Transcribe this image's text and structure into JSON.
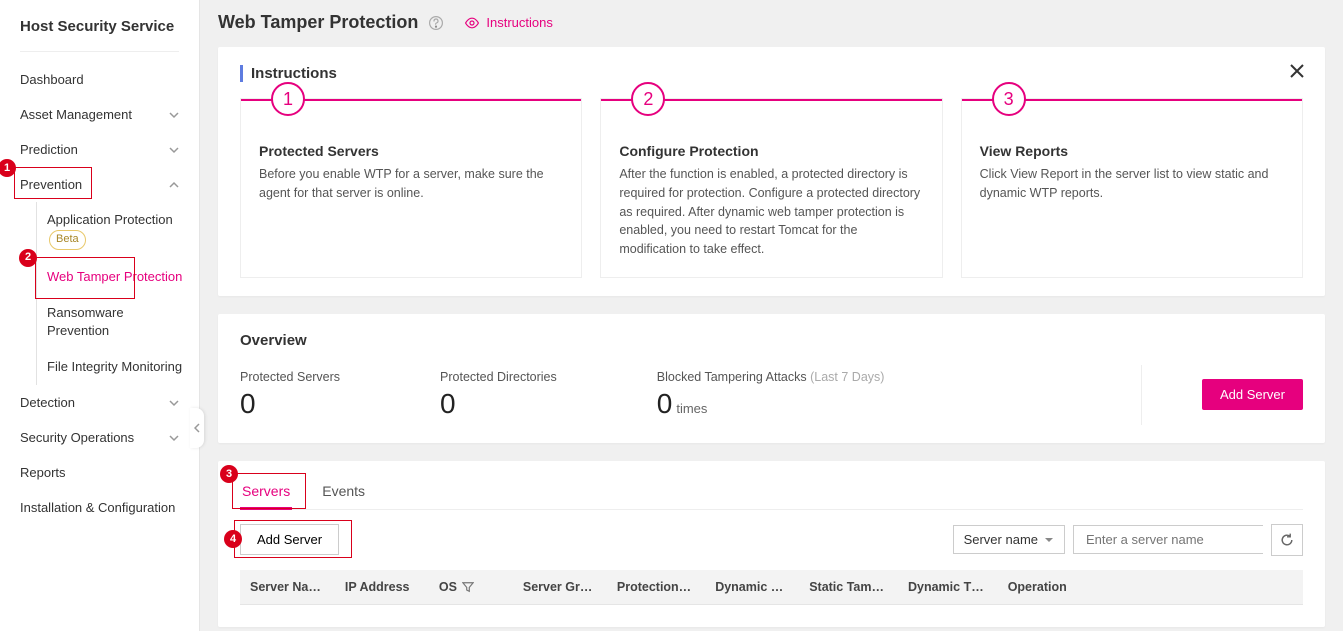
{
  "sidebar": {
    "service_title": "Host Security Service",
    "items": {
      "dashboard": "Dashboard",
      "asset_mgmt": "Asset Management",
      "prediction": "Prediction",
      "prevention": "Prevention",
      "detection": "Detection",
      "security_ops": "Security Operations",
      "reports": "Reports",
      "install_config": "Installation & Configuration"
    },
    "prevention_sub": {
      "app_protection": "Application Protection",
      "beta": "Beta",
      "wtp": "Web Tamper Protection",
      "ransomware": "Ransomware Prevention",
      "fim": "File Integrity Monitoring"
    }
  },
  "header": {
    "page_title": "Web Tamper Protection",
    "instructions_link": "Instructions"
  },
  "instructions": {
    "panel_title": "Instructions",
    "steps": [
      {
        "num": "1",
        "title": "Protected Servers",
        "body": "Before you enable WTP for a server, make sure the agent for that server is online."
      },
      {
        "num": "2",
        "title": "Configure Protection",
        "body": "After the function is enabled, a protected directory is required for protection. Configure a protected directory as required. After dynamic web tamper protection is enabled, you need to restart Tomcat for the modification to take effect."
      },
      {
        "num": "3",
        "title": "View Reports",
        "body": "Click View Report in the server list to view static and dynamic WTP reports."
      }
    ]
  },
  "overview": {
    "title": "Overview",
    "protected_servers_label": "Protected Servers",
    "protected_servers_value": "0",
    "protected_dirs_label": "Protected Directories",
    "protected_dirs_value": "0",
    "blocked_label_a": "Blocked Tampering Attacks",
    "blocked_label_b": "(Last 7 Days)",
    "blocked_value": "0",
    "blocked_unit": "times",
    "add_server_btn": "Add Server"
  },
  "table": {
    "tabs": {
      "servers": "Servers",
      "events": "Events"
    },
    "add_server_btn": "Add Server",
    "filter_select": "Server name",
    "search_placeholder": "Enter a server name",
    "columns": {
      "server_name": "Server Na…",
      "ip": "IP Address",
      "os": "OS",
      "server_group": "Server Gr…",
      "protection": "Protection…",
      "dynamic": "Dynamic …",
      "static_tam": "Static Tam…",
      "dynamic_t": "Dynamic T…",
      "operation": "Operation"
    }
  },
  "markers": {
    "m1": "1",
    "m2": "2",
    "m3": "3",
    "m4": "4"
  }
}
